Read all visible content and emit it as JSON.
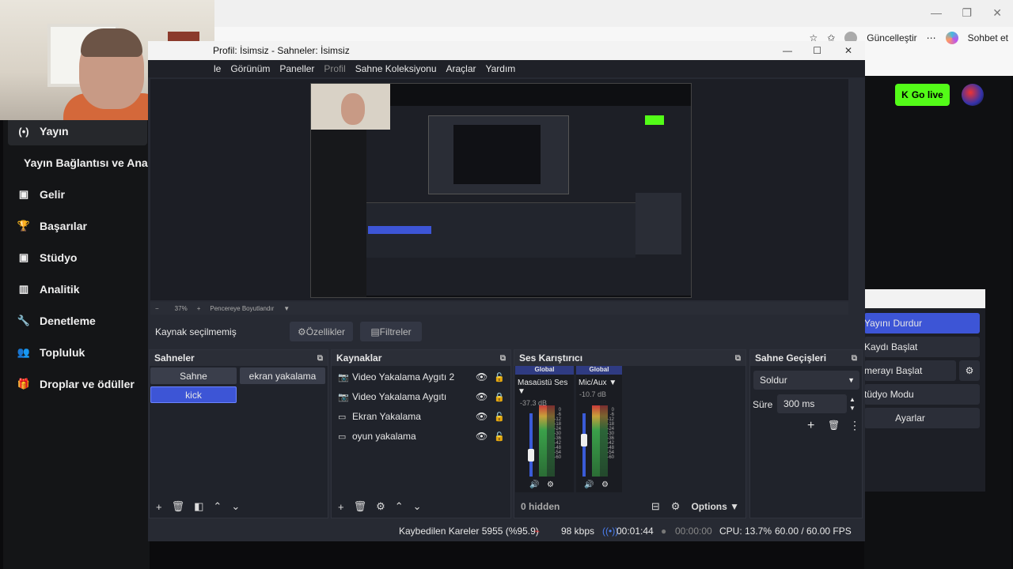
{
  "browser": {
    "update_label": "Güncelleştir",
    "more_label": "⋯",
    "chat_label": "Sohbet et",
    "star_icon": "☆",
    "fav_icon": "✩"
  },
  "kick": {
    "nav": [
      {
        "icon": "(•)",
        "label": "Yayın"
      },
      {
        "icon": "",
        "label": "Yayın Bağlantısı ve Anal"
      },
      {
        "icon": "▣",
        "label": "Gelir"
      },
      {
        "icon": "🏆",
        "label": "Başarılar"
      },
      {
        "icon": "▣",
        "label": "Stüdyo"
      },
      {
        "icon": "▥",
        "label": "Analitik"
      },
      {
        "icon": "🔧",
        "label": "Denetleme"
      },
      {
        "icon": "👥",
        "label": "Topluluk"
      },
      {
        "icon": "🎁",
        "label": "Droplar ve ödüller"
      }
    ],
    "go_live_icon": "K",
    "go_live_label": "Go live",
    "dock_buttons": [
      "Yayını Durdur",
      "Kaydı Başlat",
      "merayı Başlat",
      "tüdyo Modu",
      "Ayarlar"
    ]
  },
  "obs": {
    "title": "Profil: İsimsiz - Sahneler: İsimsiz",
    "menu": [
      "le",
      "Görünüm",
      "Paneller",
      "Profil",
      "Sahne Koleksiyonu",
      "Araçlar",
      "Yardım"
    ],
    "zoom": {
      "minus": "−",
      "value": "37%",
      "plus": "+",
      "fit": "Pencereye Boyutlandır"
    },
    "no_source": "Kaynak seçilmemiş",
    "properties": "Özellikler",
    "filters": "Filtreler",
    "scenes_title": "Sahneler",
    "scenes": [
      "Sahne",
      "ekran yakalama",
      "kick"
    ],
    "sources_title": "Kaynaklar",
    "sources": [
      {
        "icon": "📷",
        "label": "Video Yakalama Aygıtı 2",
        "lock": "🔓"
      },
      {
        "icon": "📷",
        "label": "Video Yakalama Aygıtı",
        "lock": "🔒"
      },
      {
        "icon": "▭",
        "label": "Ekran Yakalama",
        "lock": "🔓"
      },
      {
        "icon": "▭",
        "label": "oyun yakalama",
        "lock": "🔓"
      }
    ],
    "mixer_title": "Ses Karıştırıcı",
    "channels": [
      {
        "tag": "Global",
        "name": "Masaüstü Ses",
        "db": "-37.3 dB",
        "level": 0.3
      },
      {
        "tag": "Global",
        "name": "Mic/Aux",
        "db": "-10.7 dB",
        "level": 0.6
      }
    ],
    "scale": [
      "0",
      "-6",
      "-12",
      "-18",
      "-24",
      "-30",
      "-36",
      "-42",
      "-48",
      "-54",
      "-60"
    ],
    "mixer_hidden": "0 hidden",
    "mixer_options": "Options",
    "transitions_title": "Sahne Geçişleri",
    "transition": "Soldur",
    "duration_label": "Süre",
    "duration": "300 ms",
    "status": {
      "dropped": "Kaybedilen Kareler 5955 (%95.9)",
      "bitrate": "98 kbps",
      "stream_time": "00:01:44",
      "rec_time": "00:00:00",
      "cpu": "CPU: 13.7%",
      "fps": "60.00 / 60.00 FPS"
    }
  }
}
